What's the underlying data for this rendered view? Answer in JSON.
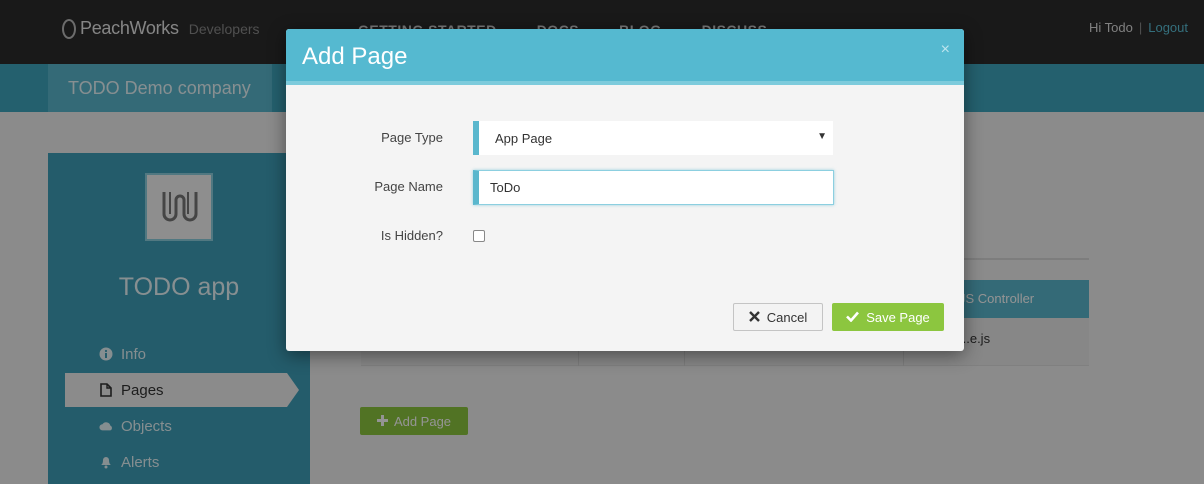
{
  "header": {
    "logo_text": "PeachWorks",
    "logo_sub": "Developers",
    "nav": [
      "GETTING STARTED",
      "DOCS",
      "BLOG",
      "DISCUSS"
    ],
    "greeting": "Hi Todo",
    "separator": "|",
    "logout": "Logout"
  },
  "company": {
    "name": "TODO Demo company"
  },
  "sidebar": {
    "app_name": "TODO app",
    "items": [
      {
        "label": "Info",
        "icon": "info-icon"
      },
      {
        "label": "Pages",
        "icon": "file-icon"
      },
      {
        "label": "Objects",
        "icon": "cloud-icon"
      },
      {
        "label": "Alerts",
        "icon": "bell-icon"
      }
    ]
  },
  "table": {
    "last_header": "JS Controller",
    "last_cell": "...e.js"
  },
  "add_page_button": "Add Page",
  "modal": {
    "title": "Add Page",
    "close": "×",
    "page_type_label": "Page Type",
    "page_type_value": "App Page",
    "page_name_label": "Page Name",
    "page_name_value": "ToDo",
    "hidden_label": "Is Hidden?",
    "hidden_checked": false,
    "cancel_label": "Cancel",
    "save_label": "Save Page"
  },
  "colors": {
    "accent": "#55b9d0",
    "sidebar": "#3e9fb8",
    "save_green": "#8cc63f",
    "topbar": "#2b2b2b"
  }
}
